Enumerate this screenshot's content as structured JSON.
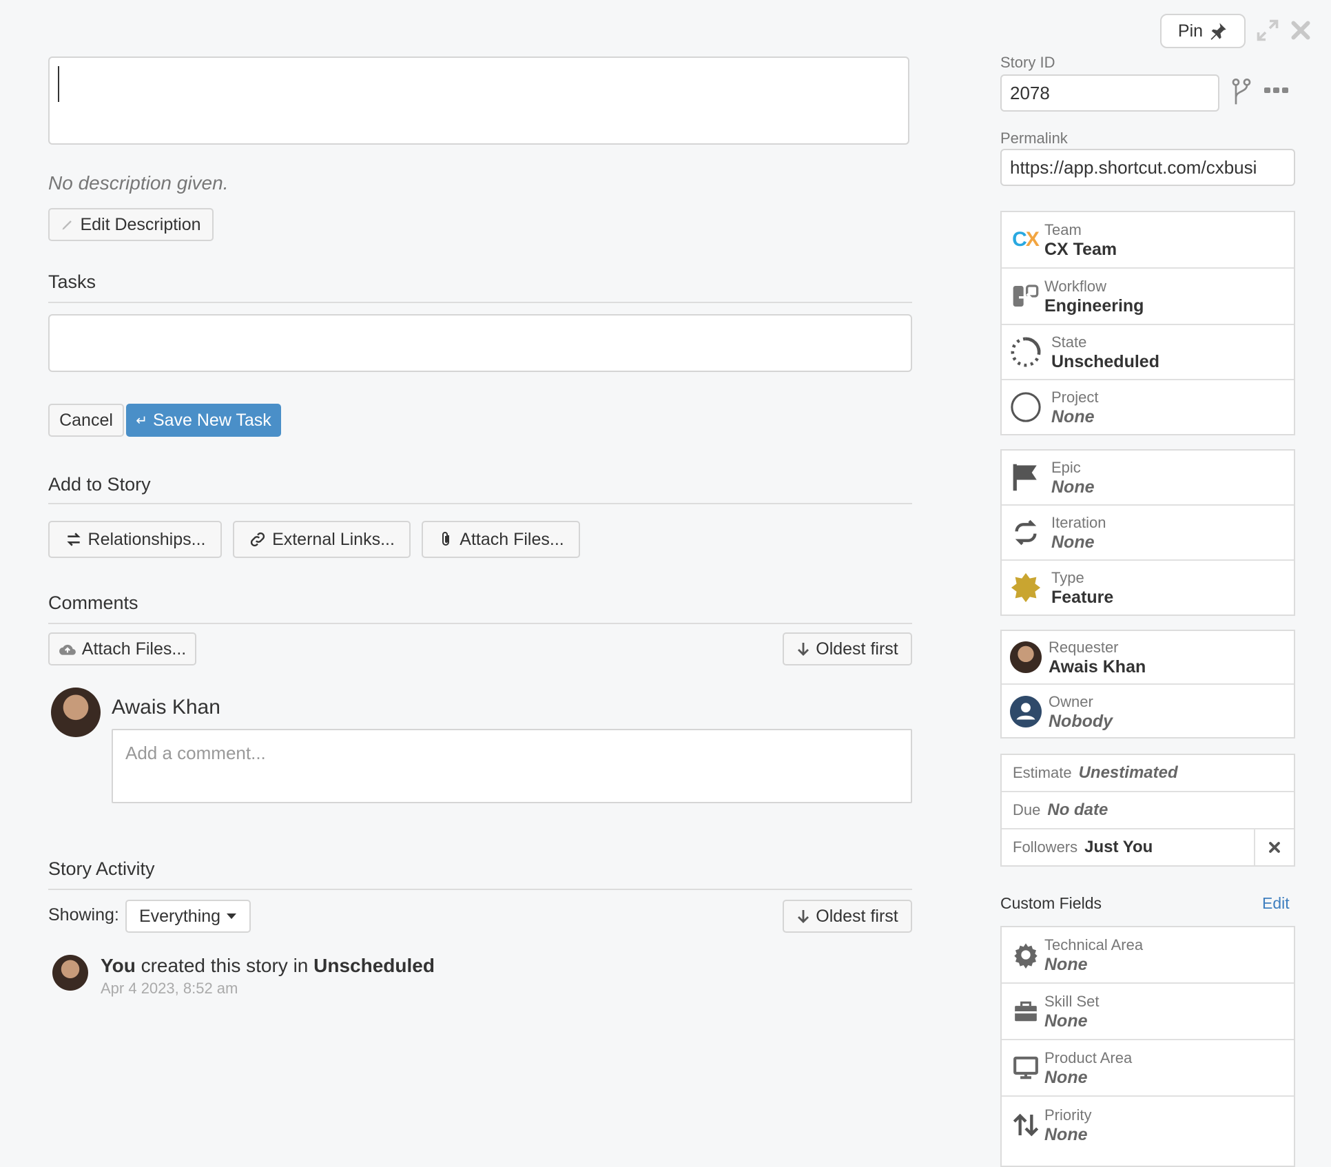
{
  "header": {
    "pin_label": "Pin"
  },
  "description": {
    "empty_text": "No description given.",
    "edit_label": "Edit Description"
  },
  "tasks": {
    "title": "Tasks",
    "cancel_label": "Cancel",
    "save_label": "Save New Task"
  },
  "add_to_story": {
    "title": "Add to Story",
    "relationships_label": "Relationships...",
    "external_links_label": "External Links...",
    "attach_files_label": "Attach Files..."
  },
  "comments": {
    "title": "Comments",
    "attach_files_label": "Attach Files...",
    "sort_label": "Oldest first",
    "author": "Awais Khan",
    "placeholder": "Add a comment..."
  },
  "activity": {
    "title": "Story Activity",
    "showing_label": "Showing:",
    "filter_value": "Everything",
    "sort_label": "Oldest first",
    "entry": {
      "actor": "You",
      "text": " created this story in ",
      "target": "Unscheduled",
      "timestamp": "Apr 4 2023, 8:52 am"
    }
  },
  "sidebar": {
    "story_id_label": "Story ID",
    "story_id_value": "2078",
    "permalink_label": "Permalink",
    "permalink_value": "https://app.shortcut.com/cxbusi",
    "group1": [
      {
        "label": "Team",
        "value": "CX Team",
        "icon": "cx-logo-icon"
      },
      {
        "label": "Workflow",
        "value": "Engineering",
        "icon": "workflow-icon"
      },
      {
        "label": "State",
        "value": "Unscheduled",
        "icon": "state-dashed-circle-icon"
      },
      {
        "label": "Project",
        "value": "None",
        "icon": "project-circle-icon"
      }
    ],
    "group2": [
      {
        "label": "Epic",
        "value": "None",
        "icon": "flag-icon"
      },
      {
        "label": "Iteration",
        "value": "None",
        "icon": "iteration-loop-icon"
      },
      {
        "label": "Type",
        "value": "Feature",
        "icon": "feature-star-icon"
      }
    ],
    "group3": [
      {
        "label": "Requester",
        "value": "Awais Khan"
      },
      {
        "label": "Owner",
        "value": "Nobody"
      }
    ],
    "estimate_label": "Estimate",
    "estimate_value": "Unestimated",
    "due_label": "Due",
    "due_value": "No date",
    "followers_label": "Followers",
    "followers_value": "Just You",
    "custom_fields_title": "Custom Fields",
    "custom_fields_edit": "Edit",
    "custom_fields": [
      {
        "label": "Technical Area",
        "value": "None",
        "icon": "gear-icon"
      },
      {
        "label": "Skill Set",
        "value": "None",
        "icon": "briefcase-icon"
      },
      {
        "label": "Product Area",
        "value": "None",
        "icon": "monitor-icon"
      },
      {
        "label": "Priority",
        "value": "None",
        "icon": "priority-arrows-icon"
      }
    ]
  },
  "colors": {
    "primary_button": "#4a8fc8",
    "feature_star": "#c9a530",
    "link": "#3f7fbf"
  }
}
